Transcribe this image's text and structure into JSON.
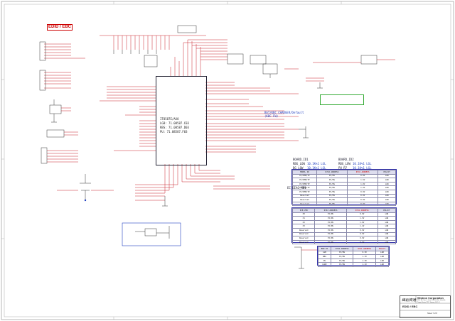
{
  "sheet": {
    "title": "EDID / EBC",
    "colors": {
      "red": "#c8202a",
      "blue": "#1f3fc0",
      "green": "#2a9a2a",
      "dark": "#222233"
    }
  },
  "chip": {
    "name": "IT8587E/AXO",
    "line1": "LGB: 71.08587.C03",
    "line2": "RBS: 71.08587.D03",
    "line3": "PU: 71.08587.F03"
  },
  "notes": {
    "blue_left": "BAT/KBC CHARGER/Default",
    "blue_left2": "(KBC FW)",
    "blue_right_label": "BOARD_ID1",
    "id1_row1": "RBG_LOW",
    "id1_row2": "BG_LOW",
    "id1_val1": "10.1K%1 LGL",
    "id1_val2": "10.1K%1 LGL",
    "id2_label": "BOARD_ID2",
    "id2_row1": "RBG_LOW",
    "id2_row2": "PU_R7",
    "id2_val1": "10.1K%1 LGL",
    "id2_val2": "10.1K%1 LGL",
    "lgb_tag": "EC_DIAG_MB1"
  },
  "tables": {
    "t1": {
      "headers": [
        "MODEL ID",
        "R742 ADDRESS",
        "R741 ADDRESS",
        "POLICY"
      ],
      "rows": [
        [
          "EC/SMB/TP",
          "EC/NS",
          "0.9V",
          "LGB"
        ],
        [
          "EC/SMB/TP",
          "EC/NS",
          "1.5V",
          "LGB"
        ],
        [
          "EC/SMB/TP",
          "EC/NS",
          "1.0V",
          "LGB"
        ],
        [
          "EC/SMB/TP",
          "EC/NS",
          "1.2V",
          "LGB"
        ],
        [
          "EC/SMB/TP",
          "EC/NS",
          "0.9V",
          "LGB"
        ],
        [
          "Reserved",
          "EC/NS",
          "0.9V",
          "LGB"
        ],
        [
          "Reserved",
          "EC/NS",
          "0.9V",
          "LGB"
        ],
        [
          "Reserved",
          "EC/NS",
          "0.9V",
          "LGB"
        ],
        [
          "Reserved",
          "EC/NS",
          "0.9V",
          "LGB"
        ]
      ]
    },
    "t2": {
      "headers": [
        "PCB VER",
        "R742 ADDRESS",
        "R741 ADDRESS",
        "POLICY"
      ],
      "rows": [
        [
          "X0",
          "EC/NS",
          "0.9V",
          "LGB"
        ],
        [
          "X1",
          "EC/NS",
          "1.5V",
          "LGB"
        ],
        [
          "X2",
          "EC/NS",
          "1.0V",
          "LGB"
        ],
        [
          "X3",
          "EC/NS",
          "1.2V",
          "LGB"
        ],
        [
          "Reserved",
          "EC/NS",
          "0.9V",
          "LGB"
        ],
        [
          "Reserved",
          "EC/NS",
          "0.9V",
          "LGB"
        ],
        [
          "Reserved",
          "EC/NS",
          "0.9V",
          "LGB"
        ],
        [
          "Reserved",
          "EC/NS",
          "0.9V",
          "LGB"
        ],
        [
          "Reserved",
          "EC/NS",
          "0.9V",
          "LGB"
        ]
      ]
    },
    "t3": {
      "headers": [
        "BRD ID",
        "R742 ADDRESS",
        "R741 ADDRESS",
        "POLICY"
      ],
      "rows": [
        [
          "LGB",
          "EC/NS",
          "0.9V",
          "LGB"
        ],
        [
          "RBG",
          "EC/NS",
          "1.5V",
          "LGB"
        ],
        [
          "PU",
          "EC/NS",
          "1.0V",
          "LGB"
        ],
        [
          "LGB2",
          "EC/NS",
          "1.2V",
          "LGB"
        ],
        [
          "Reserved",
          "EC/NS",
          "0.9V",
          "LGB"
        ]
      ]
    }
  },
  "titleblock": {
    "company": "Wistron Corporation",
    "address": "21F, 88, Sec.1, Hsin Tai Wu Rd., Hsichih,",
    "address2": "Taipei Hsien 221, Taiwan, R.O.C.",
    "logo": "緯創資通",
    "doc": "EDID / EBC",
    "sheet_no": "Sheet 7 of 8"
  }
}
